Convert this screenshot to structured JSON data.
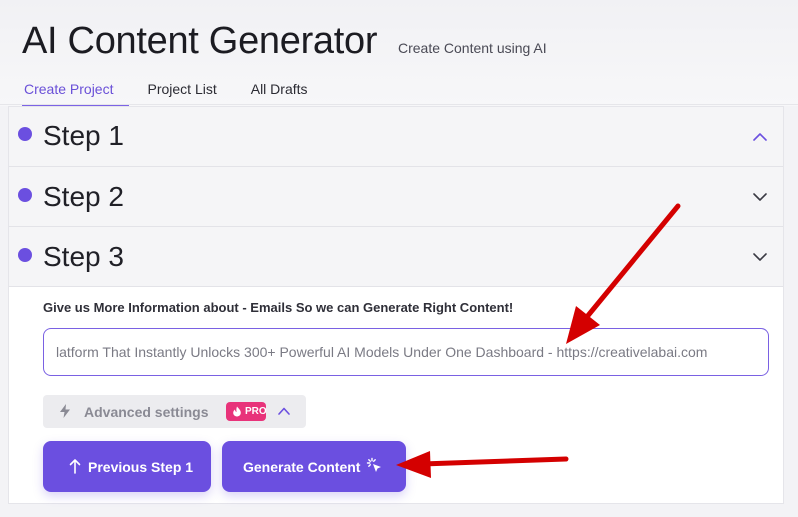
{
  "header": {
    "title": "AI Content Generator",
    "subtitle": "Create Content using AI"
  },
  "tabs": [
    {
      "label": "Create Project",
      "active": true
    },
    {
      "label": "Project List",
      "active": false
    },
    {
      "label": "All Drafts",
      "active": false
    }
  ],
  "steps": [
    {
      "label": "Step 1",
      "chevron": "chevron-up-icon"
    },
    {
      "label": "Step 2",
      "chevron": "chevron-down-icon"
    },
    {
      "label": "Step 3",
      "chevron": "chevron-down-icon"
    }
  ],
  "form": {
    "info_label": "Give us More Information about - Emails So we can Generate Right Content!",
    "info_value": "latform That Instantly Unlocks 300+ Powerful AI Models Under One Dashboard - https://creativelabai.com",
    "advanced_settings_label": "Advanced settings",
    "pro_badge": "PRO"
  },
  "buttons": {
    "previous_label": "Previous Step 1",
    "generate_label": "Generate Content"
  },
  "icons": {
    "advanced": "bolt-icon",
    "pro": "flame-icon",
    "previous": "arrow-up-icon",
    "generate": "cursor-click-icon"
  },
  "colors": {
    "accent": "#6b4fe0",
    "pro": "#e8337a",
    "annotation_arrow": "#d40000"
  }
}
